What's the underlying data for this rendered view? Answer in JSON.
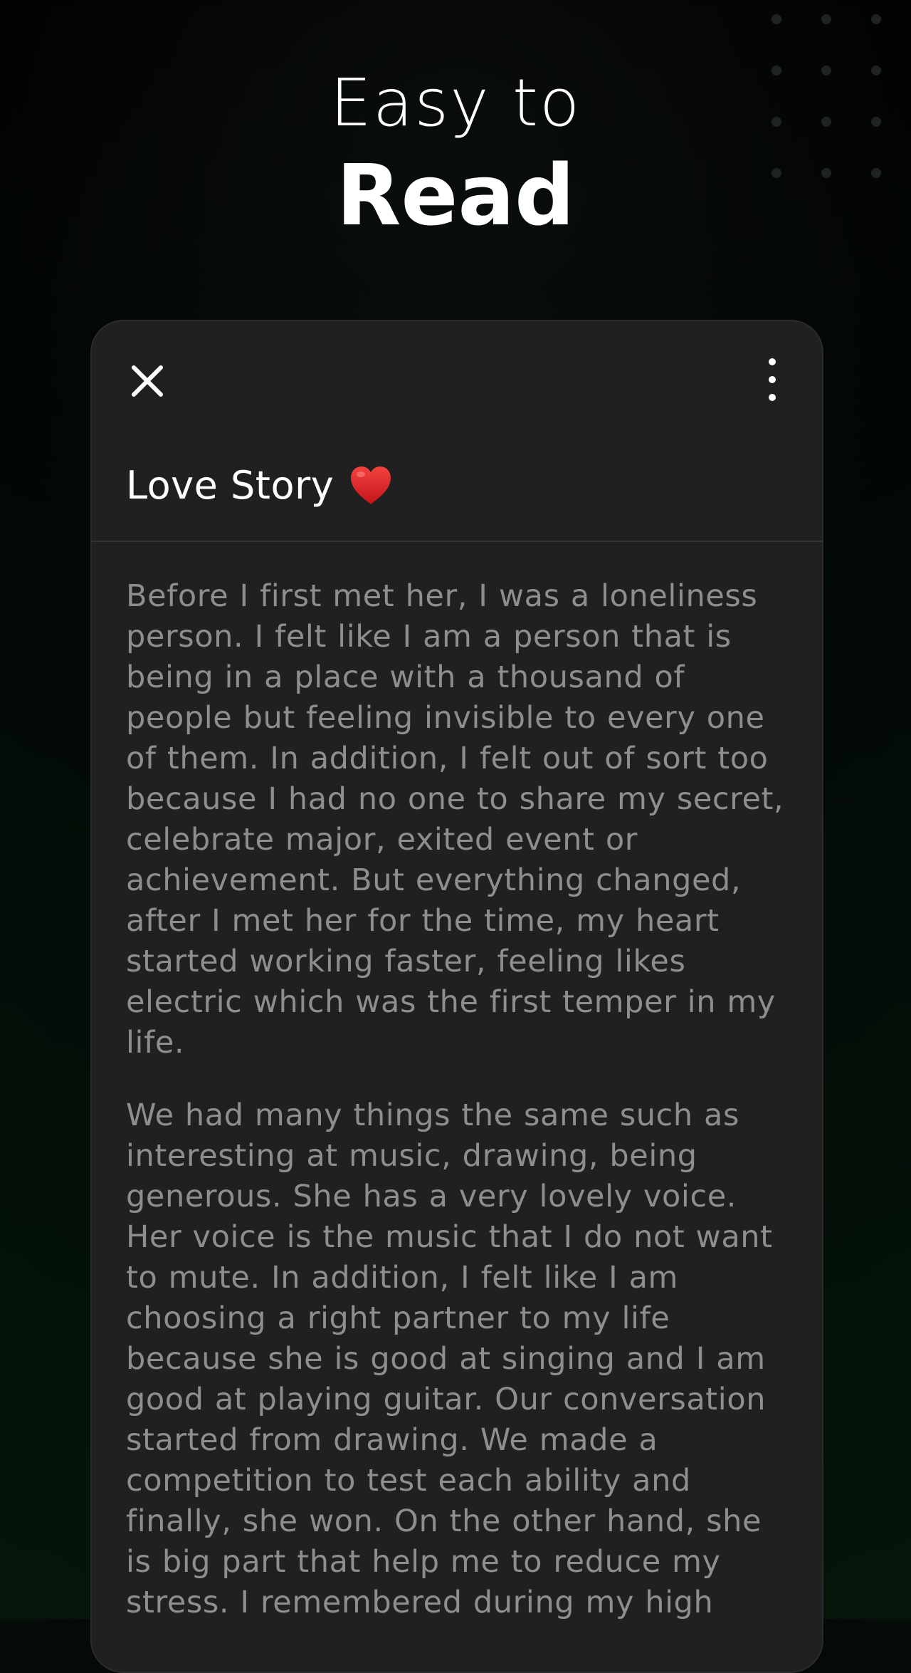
{
  "hero": {
    "line1": "Easy to",
    "line2": "Read"
  },
  "card": {
    "close_icon": "close-icon",
    "more_icon": "more-vertical-icon",
    "title": "Love Story",
    "title_emoji_icon": "red-heart-icon",
    "paragraphs": [
      "Before I first met her, I was a loneliness person. I felt like I am a person that is being in a place with a thousand of people but feeling invisible to every one of them. In addition, I felt out of sort too because I had no one to share my secret, celebrate major, exited event or achievement. But everything changed, after I met her for the time, my heart started working faster, feeling likes electric which was the first temper in my life.",
      "We had many things the same such as interesting at music, drawing, being generous. She has a very lovely voice. Her voice is the music that I do not want to mute. In addition, I felt like I am choosing a right partner to my life because she is good at singing and I am good at playing guitar. Our conversation started from drawing. We made a competition to test each ability and finally, she won. On the other hand, she is big part that help me to reduce my stress. I remembered during my high"
    ]
  },
  "colors": {
    "background": "#050806",
    "card_background": "#202020",
    "body_text": "#8e8e8e",
    "title_text": "#ffffff",
    "heart": "#e0202a"
  }
}
